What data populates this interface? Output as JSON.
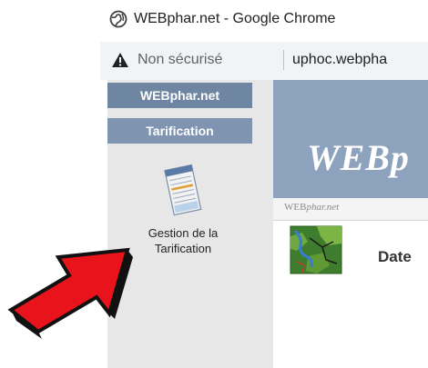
{
  "window": {
    "title": "WEBphar.net - Google Chrome",
    "icon": "globe-icon"
  },
  "address_bar": {
    "security_label": "Non sécurisé",
    "url": "uphoc.webpha",
    "icon": "warning-icon"
  },
  "sidebar": {
    "site_tab": "WEBphar.net",
    "section_tab": "Tarification",
    "item": {
      "label_line1": "Gestion de la",
      "label_line2": "Tarification",
      "icon": "price-list-icon"
    }
  },
  "main": {
    "banner_title": "WEBp",
    "sub_title_plain": "WEB",
    "sub_title_italic": "phar.net",
    "row_label": "Date",
    "row_icon": "map-icon"
  },
  "annotation": {
    "icon": "red-arrow-icon",
    "color": "#e8131b"
  },
  "colors": {
    "sidebar_tab": "#6f86a3",
    "banner": "#8da2bd",
    "arrow": "#e8131b"
  }
}
